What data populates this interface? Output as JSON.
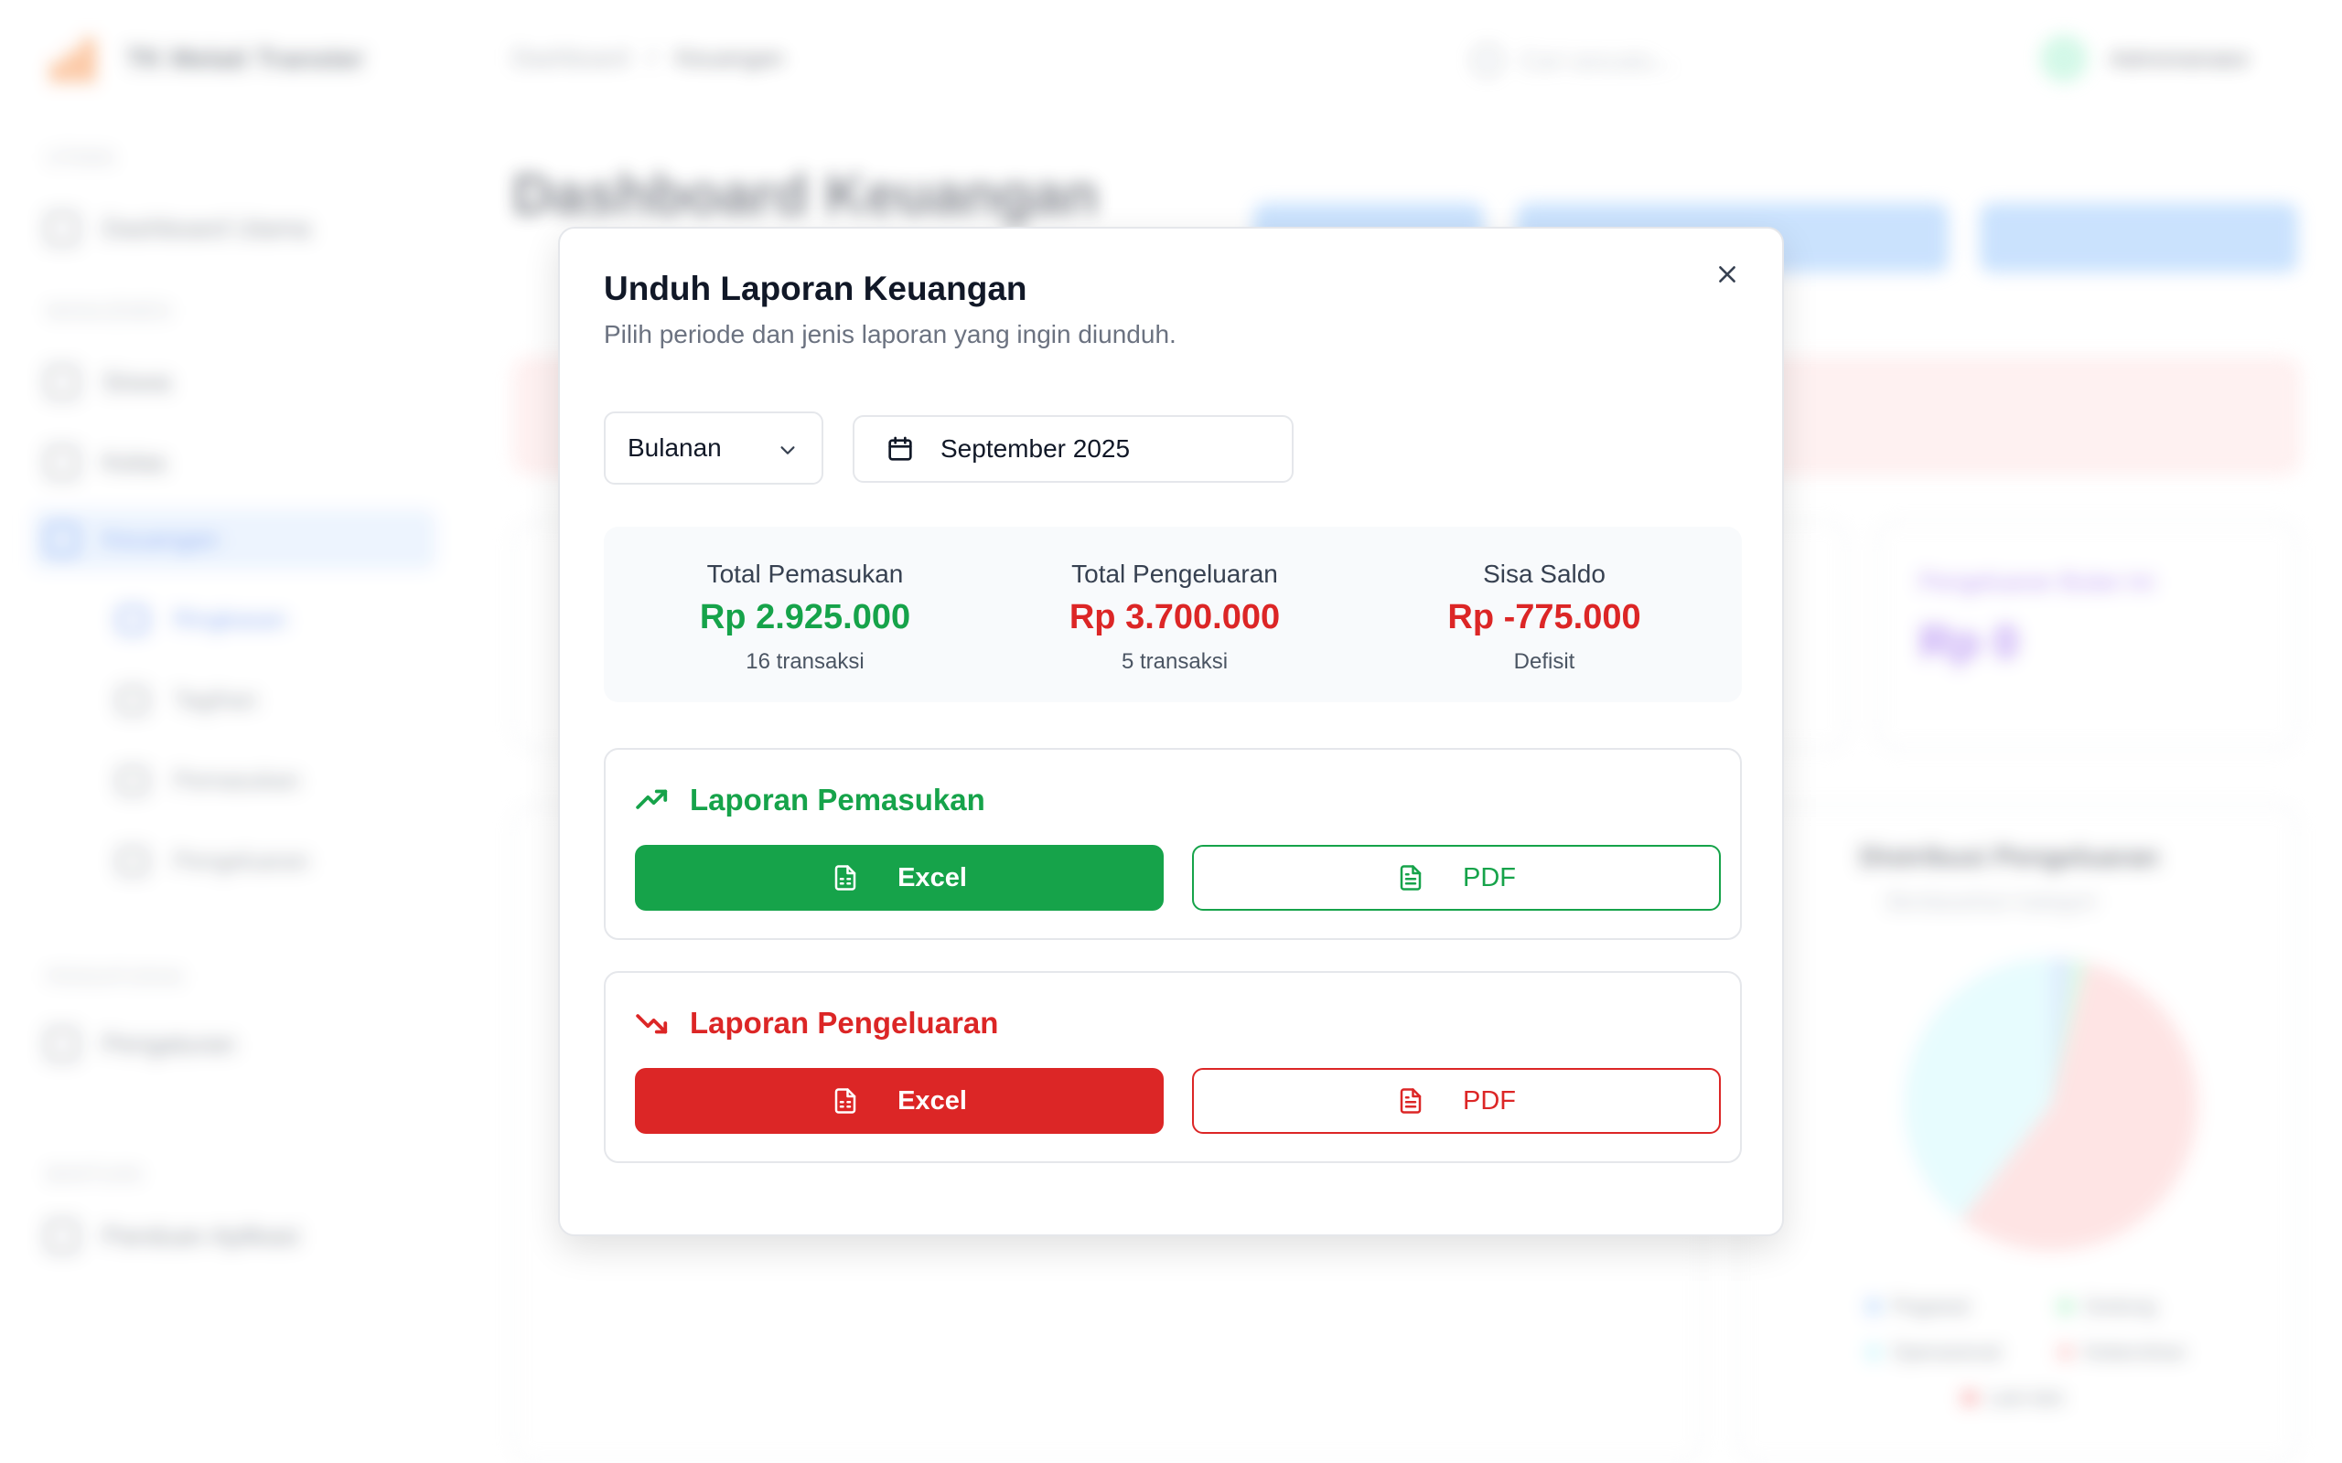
{
  "background": {
    "app_name": "TK Melati Transter",
    "sections": [
      "UTAMA",
      "MANAJEMEN",
      "PENGATURAN",
      "BANTUAN"
    ],
    "nav": {
      "dashboard": "Dashboard Utama",
      "siswa": "Siswa",
      "kelas": "Kelas",
      "keuangan": "Keuangan",
      "pengaturan": "Pengaturan",
      "bantuan": "Panduan Aplikasi"
    },
    "subnav": [
      "Ringkasan",
      "Tagihan",
      "Pemasukan",
      "Pengeluaran"
    ],
    "breadcrumb": [
      "Dashboard",
      "/",
      "Keuangan"
    ],
    "search_placeholder": "Cari sesuatu...",
    "user_name": "Administrator",
    "page_title": "Dashboard Keuangan",
    "card_title": "Pengeluaran Bulan Ini",
    "card_value": "Rp 0",
    "panel_title": "Distribusi Pengeluaran",
    "panel_sub": "Berdasarkan kategori",
    "legend": [
      "Pegawai",
      "Gedung",
      "Operasional",
      "Kebersihan",
      "Lain-lain"
    ]
  },
  "modal": {
    "title": "Unduh Laporan Keuangan",
    "description": "Pilih periode dan jenis laporan yang ingin diunduh.",
    "period_select": "Bulanan",
    "date_value": "September 2025",
    "summary": [
      {
        "label": "Total Pemasukan",
        "value": "Rp 2.925.000",
        "note": "16 transaksi",
        "color": "#16a34a"
      },
      {
        "label": "Total Pengeluaran",
        "value": "Rp 3.700.000",
        "note": "5 transaksi",
        "color": "#dc2626"
      },
      {
        "label": "Sisa Saldo",
        "value": "Rp -775.000",
        "note": "Defisit",
        "color": "#dc2626"
      }
    ],
    "income_report": {
      "title": "Laporan Pemasukan",
      "excel_label": "Excel",
      "pdf_label": "PDF",
      "color": "#16a34a"
    },
    "expense_report": {
      "title": "Laporan Pengeluaran",
      "excel_label": "Excel",
      "pdf_label": "PDF",
      "color": "#dc2626"
    }
  },
  "icons": [
    "close-icon",
    "chevron-down-icon",
    "calendar-icon",
    "trending-up-icon",
    "trending-down-icon",
    "spreadsheet-icon",
    "file-text-icon"
  ]
}
